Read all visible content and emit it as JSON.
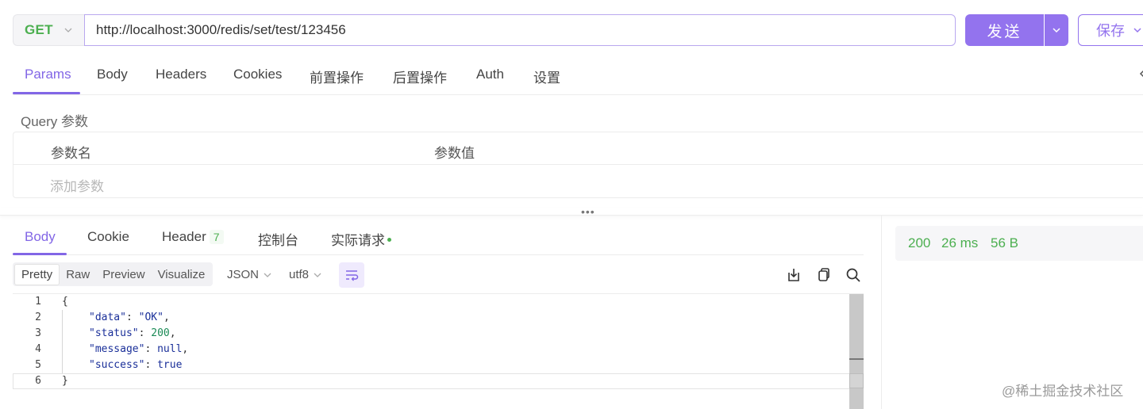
{
  "request": {
    "method": "GET",
    "url": "http://localhost:3000/redis/set/test/123456",
    "send_label": "发送",
    "save_label": "保存"
  },
  "request_tabs": [
    {
      "label": "Params",
      "active": true
    },
    {
      "label": "Body"
    },
    {
      "label": "Headers"
    },
    {
      "label": "Cookies"
    },
    {
      "label": "前置操作"
    },
    {
      "label": "后置操作"
    },
    {
      "label": "Auth"
    },
    {
      "label": "设置"
    }
  ],
  "params": {
    "section_title": "Query 参数",
    "col_name": "参数名",
    "col_value": "参数值",
    "add_placeholder": "添加参数"
  },
  "response_tabs": [
    {
      "label": "Body",
      "active": true
    },
    {
      "label": "Cookie"
    },
    {
      "label": "Header",
      "count": "7"
    },
    {
      "label": "控制台"
    },
    {
      "label": "实际请求",
      "dot": true
    }
  ],
  "view_modes": [
    "Pretty",
    "Raw",
    "Preview",
    "Visualize"
  ],
  "format": "JSON",
  "encoding": "utf8",
  "code_lines": [
    {
      "num": "1",
      "text": "{"
    },
    {
      "num": "2",
      "key": "\"data\"",
      "value": "\"OK\"",
      "vtype": "s",
      "tail": ","
    },
    {
      "num": "3",
      "key": "\"status\"",
      "value": "200",
      "vtype": "n",
      "tail": ","
    },
    {
      "num": "4",
      "key": "\"message\"",
      "value": "null",
      "vtype": "b",
      "tail": ","
    },
    {
      "num": "5",
      "key": "\"success\"",
      "value": "true",
      "vtype": "b",
      "tail": ""
    },
    {
      "num": "6",
      "text": "}"
    }
  ],
  "status": {
    "code": "200",
    "time": "26 ms",
    "size": "56 B"
  },
  "watermark": "@稀土掘金技术社区",
  "colors": {
    "accent": "#8266e6",
    "button": "#9373ee",
    "success": "#4caf50"
  }
}
